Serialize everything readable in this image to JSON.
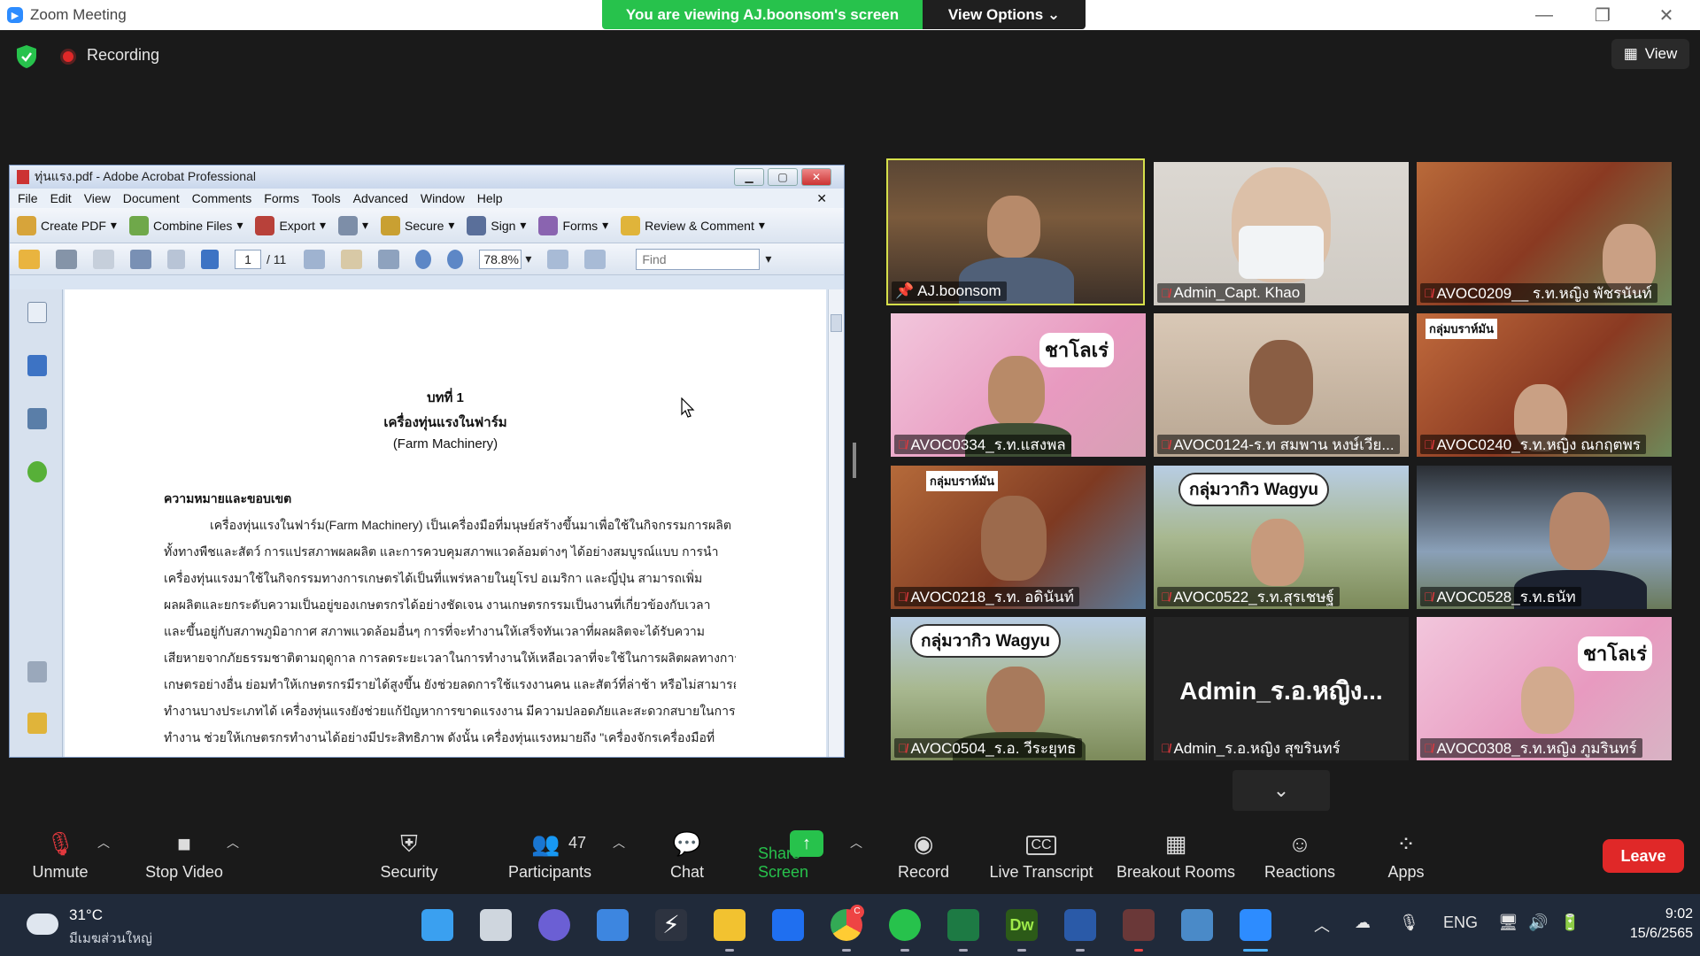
{
  "window": {
    "title": "Zoom Meeting",
    "viewing_banner": "You are viewing AJ.boonsom's screen",
    "view_options": "View Options",
    "recording": "Recording",
    "view_button": "View"
  },
  "acrobat": {
    "title": "ทุ่นแรง.pdf - Adobe Acrobat Professional",
    "menu": [
      "File",
      "Edit",
      "View",
      "Document",
      "Comments",
      "Forms",
      "Tools",
      "Advanced",
      "Window",
      "Help"
    ],
    "toolbar": [
      "Create PDF",
      "Combine Files",
      "Export",
      "",
      "Secure",
      "Sign",
      "Forms",
      "Review & Comment"
    ],
    "page_current": "1",
    "page_total": "/ 11",
    "zoom": "78.8%",
    "find_placeholder": "Find",
    "doc": {
      "chapter": "บทที่ 1",
      "heading": "เครื่องทุ่นแรงในฟาร์ม",
      "subheading": "(Farm Machinery)",
      "section": "ความหมายและขอบเขต",
      "lines": [
        "เครื่องทุ่นแรงในฟาร์ม(Farm Machinery) เป็นเครื่องมือที่มนุษย์สร้างขึ้นมาเพื่อใช้ในกิจกรรมการผลิต",
        "ทั้งทางพืชและสัตว์ การแปรสภาพผลผลิต และการควบคุมสภาพแวดล้อมต่างๆ ได้อย่างสมบูรณ์แบบ การนำ",
        "เครื่องทุ่นแรงมาใช้ในกิจกรรมทางการเกษตรได้เป็นที่แพร่หลายในยุโรป อเมริกา และญี่ปุ่น สามารถเพิ่ม",
        "ผลผลิตและยกระดับความเป็นอยู่ของเกษตรกรได้อย่างชัดเจน งานเกษตรกรรมเป็นงานที่เกี่ยวข้องกับเวลา",
        "และขึ้นอยู่กับสภาพภูมิอากาศ สภาพแวดล้อมอื่นๆ การที่จะทำงานให้เสร็จทันเวลาที่ผลผลิตจะได้รับความ",
        "เสียหายจากภัยธรรมชาติตามฤดูกาล การลดระยะเวลาในการทำงานให้เหลือเวลาที่จะใช้ในการผลิตผลทางการ",
        "เกษตรอย่างอื่น ย่อมทำให้เกษตรกรมีรายได้สูงขึ้น ยังช่วยลดการใช้แรงงานคน และสัตว์ที่ล่าช้า หรือไม่สามารถ",
        "ทำงานบางประเภทได้ เครื่องทุ่นแรงยังช่วยแก้ปัญหาการขาดแรงงาน มีความปลอดภัยและสะดวกสบายในการ",
        "ทำงาน ช่วยให้เกษตรกรทำงานได้อย่างมีประสิทธิภาพ ดังนั้น เครื่องทุ่นแรงหมายถึง \"เครื่องจักรเครื่องมือที่"
      ]
    }
  },
  "participants_tiles": [
    {
      "name": "AJ.boonsom",
      "active": true
    },
    {
      "name": "Admin_Capt. Khao"
    },
    {
      "name": "AVOC0209__ ร.ท.หญิง พัชรนันท์"
    },
    {
      "name": "AVOC0334_ร.ท.แสงพล"
    },
    {
      "name": "AVOC0124-ร.ท สมพาน หงษ์เวีย..."
    },
    {
      "name": "AVOC0240_ร.ท.หญิง ณกฤตพร"
    },
    {
      "name": "AVOC0218_ร.ท. อดินันท์"
    },
    {
      "name": "AVOC0522_ร.ท.สุรเชษฐ์"
    },
    {
      "name": "AVOC0528_ร.ท.ธนัท"
    },
    {
      "name": "AVOC0504_ร.อ. วีระยุทธ"
    },
    {
      "name": "Admin_ร.อ.หญิง สุขรินทร์",
      "video_off_label": "Admin_ร.อ.หญิง..."
    },
    {
      "name": "AVOC0308_ร.ท.หญิง ภูมรินทร์"
    }
  ],
  "stickers": {
    "sharolais": "ชาโลเร่",
    "wagyu": "กลุ่มวากิว Wagyu",
    "brahman": "กลุ่มบราห์มัน"
  },
  "toolbar": {
    "unmute": "Unmute",
    "stop_video": "Stop Video",
    "security": "Security",
    "participants": "Participants",
    "participant_count": "47",
    "chat": "Chat",
    "share_screen": "Share Screen",
    "record": "Record",
    "live_transcript": "Live Transcript",
    "breakout_rooms": "Breakout Rooms",
    "reactions": "Reactions",
    "apps": "Apps",
    "leave": "Leave"
  },
  "taskbar": {
    "temperature": "31°C",
    "weather_desc": "มีเมฆส่วนใหญ่",
    "language": "ENG",
    "time": "9:02",
    "date": "15/6/2565",
    "chrome_badge": "C"
  },
  "colors": {
    "accent_green": "#27c24c",
    "leave_red": "#e02828",
    "active_speaker": "#d6e04a",
    "zoom_blue": "#2d8cff"
  }
}
